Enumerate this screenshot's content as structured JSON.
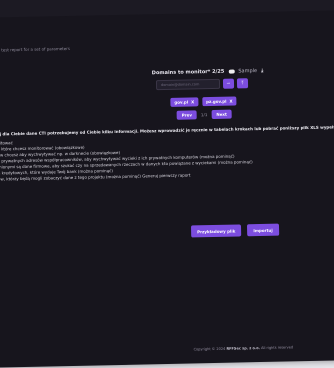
{
  "page": {
    "subtitle": "test report for a set of parameters"
  },
  "domains": {
    "title": "Domains to monitor* 2/25",
    "sample_label": "Sample",
    "input_placeholder": "domain@domain.com",
    "add_icon": "minus-icon",
    "upload_icon": "upload-icon",
    "chips": [
      {
        "label": "gov.pl",
        "remove": "X"
      },
      {
        "label": "pz.gov.pl",
        "remove": "X"
      }
    ]
  },
  "pagination": {
    "prev": "Prev",
    "info": "1/1",
    "next": "Next"
  },
  "description": {
    "lines": [
      "ej dla Ciebie dane CTI potrzebujemy od Ciebie kilku informacji. Możesz wprowadzić je ręcznie w tabelach krokach lub pobrać poniższy plik XLS wypełni",
      "",
      "nitować",
      "ę które chcesz monitorować (obowiązkowe)",
      "ów chcesz aby wychwytywać np. w darknecie (obowiązkowe)",
      "ą prywatnych adresów współpracowników, aby wychwytywać wycieki z ich prywatnych komputerów (można pominąć)",
      "mionymi są dane firmowe, aby szukać czy na sprzedawanych rzeczach w danych kto powiązane z wyciekami (można pominąć)",
      "h kredytowych, które wydaje Twój bank (można pominąć)",
      "ów, którzy będą mogli zobaczyć dane z tego projektu (można pominąć) Generuj pierwszy raport"
    ]
  },
  "actions": {
    "sample_file": "Przykładowy plik",
    "import": "Importuj"
  },
  "footer": {
    "prefix": "Copyright © 2024",
    "company": "RFFSec sp. z o.o.",
    "suffix": "All rights reserved"
  }
}
